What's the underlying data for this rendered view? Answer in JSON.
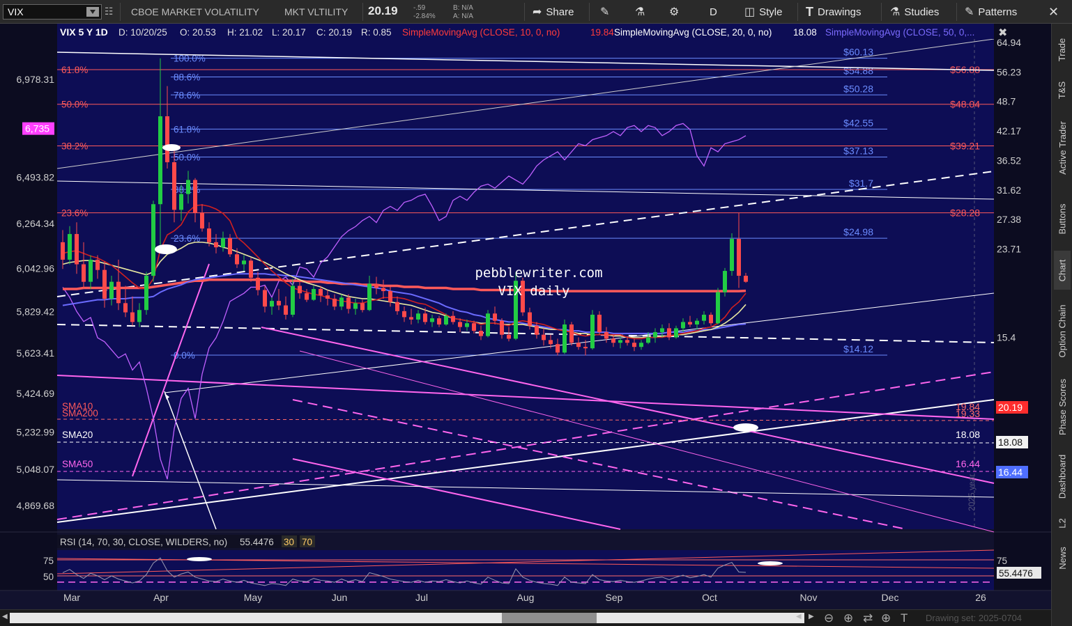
{
  "toolbar": {
    "symbol": "VIX",
    "desc1": "CBOE MARKET VOLATILITY",
    "desc2": "MKT VLTILITY",
    "last": "20.19",
    "change": "-.59",
    "change_pct": "-2.84%",
    "bid": "B: N/A",
    "ask": "A: N/A",
    "share": "Share",
    "period": "D",
    "style": "Style",
    "drawings": "Drawings",
    "studies": "Studies",
    "patterns": "Patterns"
  },
  "sidebar": [
    "Trade",
    "T&S",
    "Active Trader",
    "Buttons",
    "Chart",
    "Option Chain",
    "Phase Scores",
    "Dashboard",
    "L2",
    "News"
  ],
  "header": {
    "title": "VIX 5 Y 1D",
    "date": "D: 10/20/25",
    "open": "O: 20.53",
    "high": "H: 21.02",
    "low": "L: 20.17",
    "close": "C: 20.19",
    "range": "R: 0.85",
    "sma10": "SimpleMovingAvg (CLOSE, 10, 0, no)",
    "sma10_val": "19.84",
    "sma20": "SimpleMovingAvg (CLOSE, 20, 0, no)",
    "sma20_val": "18.08",
    "sma50": "SimpleMovingAvg (CLOSE, 50, 0,..."
  },
  "watermark": {
    "line1": "pebblewriter.com",
    "line2": "VIX daily",
    "year": "2025 year"
  },
  "rsi": {
    "label": "RSI (14, 70, 30, CLOSE, WILDERS, no)",
    "value": "55.4476",
    "ob": "30",
    "os": "70",
    "tick75": "75",
    "tick50": "50",
    "rvalue": "55.4476",
    "rtick75": "75"
  },
  "scroll": {
    "drawing_set": "Drawing set: 2025-0704"
  },
  "chart_data": {
    "type": "candlestick",
    "title": "VIX 5 Y 1D",
    "x_labels": [
      "Mar",
      "Apr",
      "May",
      "Jun",
      "Jul",
      "Aug",
      "Sep",
      "Oct",
      "Nov",
      "Dec",
      "26"
    ],
    "right_axis": [
      "64.94",
      "56.23",
      "48.7",
      "42.17",
      "36.52",
      "31.62",
      "27.38",
      "23.71",
      "15.4"
    ],
    "left_axis": [
      "6,978.31",
      "6,493.82",
      "6,264.34",
      "6,042.96",
      "5,829.42",
      "5,623.41",
      "5,424.69",
      "5,232.99",
      "5,048.07",
      "4,869.68"
    ],
    "left_marker": "6,735",
    "right_markers": [
      {
        "label": "20.19",
        "value": 20.19,
        "color": "#ff2d2d"
      },
      {
        "label": "18.08",
        "value": 18.08,
        "color": "#ffffff"
      },
      {
        "label": "16.44",
        "value": 16.44,
        "color": "#4f6fff"
      }
    ],
    "fib_right": [
      {
        "label": "$60.13",
        "value": 60.13
      },
      {
        "label": "$54.88",
        "value": 54.88
      },
      {
        "label": "$50.28",
        "value": 50.28
      },
      {
        "label": "$42.55",
        "value": 42.55
      },
      {
        "label": "$37.13",
        "value": 37.13
      },
      {
        "label": "$31.7",
        "value": 31.7
      },
      {
        "label": "$24.98",
        "value": 24.98
      },
      {
        "label": "$14.12",
        "value": 14.12
      }
    ],
    "fib_red": [
      {
        "label": "$56.88",
        "value": 56.88,
        "pct": "61.8%"
      },
      {
        "label": "$48.04",
        "value": 48.04,
        "pct": "50.0%"
      },
      {
        "label": "$39.21",
        "value": 39.21,
        "pct": "38.2%"
      },
      {
        "label": "$28.28",
        "value": 28.28,
        "pct": "23.6%"
      }
    ],
    "fib_left_pct": [
      {
        "label": "100.0%",
        "value": 60.13
      },
      {
        "label": "88.6%",
        "value": 54.88
      },
      {
        "label": "78.6%",
        "value": 50.28
      },
      {
        "label": "61.8%",
        "value": 42.55
      },
      {
        "label": "50.0%",
        "value": 37.13
      },
      {
        "label": "38.2%",
        "value": 31.7
      },
      {
        "label": "23.6%",
        "value": 24.98
      },
      {
        "label": "0.0%",
        "value": 14.12
      }
    ],
    "ma_labels": [
      {
        "label": "19.84",
        "value": 19.84,
        "color": "#ff6a6a"
      },
      {
        "label": "19.33",
        "value": 19.33,
        "color": "#ff6a6a"
      },
      {
        "label": "18.08",
        "value": 18.08,
        "color": "#ffffff"
      },
      {
        "label": "16.44",
        "value": 16.44,
        "color": "#ff66ee"
      }
    ],
    "ma_left": [
      "SMA10",
      "SMA200",
      "SMA20",
      "SMA50"
    ],
    "ohlc": [
      [
        24.5,
        26,
        21.5,
        22.5
      ],
      [
        22.5,
        26.5,
        22,
        25.5
      ],
      [
        25.5,
        27,
        21,
        22
      ],
      [
        22,
        24.5,
        19.5,
        20.2
      ],
      [
        20.2,
        23,
        19.5,
        22.5
      ],
      [
        22.5,
        23,
        20.5,
        21.4
      ],
      [
        21.4,
        22.3,
        17.8,
        18.6
      ],
      [
        18.6,
        20.8,
        18,
        20.2
      ],
      [
        20.2,
        22.5,
        17.6,
        18.2
      ],
      [
        18.2,
        19.8,
        17,
        17.4
      ],
      [
        17.4,
        18.8,
        16.3,
        16.6
      ],
      [
        16.6,
        18.2,
        16.2,
        17.6
      ],
      [
        17.6,
        21.2,
        17.2,
        20.8
      ],
      [
        20.8,
        30,
        20.2,
        29.5
      ],
      [
        29.5,
        60.1,
        24,
        45.3
      ],
      [
        45.3,
        52.5,
        35.1,
        36.2
      ],
      [
        36.2,
        38.4,
        27,
        28.7
      ],
      [
        28.7,
        32.5,
        27.2,
        31
      ],
      [
        31,
        34.7,
        29.6,
        33.2
      ],
      [
        33.2,
        33.5,
        27,
        28.3
      ],
      [
        28.3,
        29.5,
        25.8,
        26.2
      ],
      [
        26.2,
        27,
        24,
        24.5
      ],
      [
        24.5,
        25.5,
        23.2,
        23.9
      ],
      [
        23.9,
        25.8,
        23.4,
        25
      ],
      [
        25,
        25.5,
        22.8,
        23.1
      ],
      [
        23.1,
        23.8,
        21.6,
        22
      ],
      [
        22,
        23,
        21.3,
        22.4
      ],
      [
        22.4,
        22.7,
        20.2,
        20.6
      ],
      [
        20.6,
        21.2,
        18.9,
        19.4
      ],
      [
        19.4,
        19.8,
        17.4,
        17.9
      ],
      [
        17.9,
        18.7,
        17.2,
        18.4
      ],
      [
        18.4,
        19.5,
        17.6,
        18
      ],
      [
        18,
        18.8,
        16.8,
        17.2
      ],
      [
        17.2,
        20.5,
        17,
        19.8
      ],
      [
        19.8,
        20.3,
        18.6,
        19.1
      ],
      [
        19.1,
        19.5,
        18.3,
        18.5
      ],
      [
        18.5,
        19.8,
        18.4,
        19.5
      ],
      [
        19.5,
        19.8,
        18.3,
        18.9
      ],
      [
        18.9,
        19.4,
        18,
        18.6
      ],
      [
        18.6,
        19,
        17.6,
        17.9
      ],
      [
        17.9,
        19,
        17.6,
        18.7
      ],
      [
        18.7,
        19,
        17.3,
        17.7
      ],
      [
        17.7,
        18.6,
        17.2,
        18.2
      ],
      [
        18.2,
        18.5,
        17.4,
        17.6
      ],
      [
        17.6,
        20.8,
        17.5,
        20
      ],
      [
        20,
        20.7,
        19,
        19.6
      ],
      [
        19.6,
        20.4,
        18.6,
        19.3
      ],
      [
        19.3,
        19.7,
        17.9,
        18.3
      ],
      [
        18.3,
        18.8,
        17.2,
        17.5
      ],
      [
        17.5,
        17.9,
        16.6,
        17
      ],
      [
        17,
        17.7,
        16.4,
        16.8
      ],
      [
        16.8,
        17.6,
        16.5,
        17.3
      ],
      [
        17.3,
        17.8,
        16.4,
        16.6
      ],
      [
        16.6,
        17.2,
        16.2,
        16.9
      ],
      [
        16.9,
        17.1,
        16.2,
        16.4
      ],
      [
        16.4,
        17.3,
        16.3,
        17.1
      ],
      [
        17.1,
        17.5,
        16.4,
        16.6
      ],
      [
        16.6,
        16.9,
        15.8,
        16.2
      ],
      [
        16.2,
        16.8,
        15.9,
        16.5
      ],
      [
        16.5,
        16.7,
        15.7,
        15.9
      ],
      [
        15.9,
        16.3,
        15.2,
        15.5
      ],
      [
        15.5,
        17.6,
        15.4,
        17.3
      ],
      [
        17.3,
        17.9,
        16.4,
        16.7
      ],
      [
        16.7,
        16.9,
        15.3,
        15.6
      ],
      [
        15.6,
        16.2,
        15.1,
        15.3
      ],
      [
        15.3,
        21.2,
        15.2,
        20.3
      ],
      [
        20.3,
        20.6,
        17.1,
        17.4
      ],
      [
        17.4,
        17.8,
        16,
        16.3
      ],
      [
        16.3,
        16.6,
        15.3,
        15.6
      ],
      [
        15.6,
        16.1,
        14.8,
        15.2
      ],
      [
        15.2,
        15.6,
        14.6,
        14.9
      ],
      [
        14.9,
        15.3,
        14.1,
        14.3
      ],
      [
        14.3,
        16.8,
        14.2,
        16.4
      ],
      [
        16.4,
        16.6,
        14.8,
        15
      ],
      [
        15,
        15.4,
        14.5,
        14.7
      ],
      [
        14.7,
        15.2,
        14.1,
        14.6
      ],
      [
        14.6,
        17.6,
        14.5,
        17.2
      ],
      [
        17.2,
        17.5,
        15.6,
        15.8
      ],
      [
        15.8,
        16.2,
        15,
        15.3
      ],
      [
        15.3,
        15.6,
        14.7,
        15
      ],
      [
        15,
        15.4,
        14.6,
        15.2
      ],
      [
        15.2,
        15.5,
        14.8,
        15
      ],
      [
        15,
        15.3,
        14.4,
        14.7
      ],
      [
        14.7,
        15.2,
        14.5,
        15
      ],
      [
        15,
        15.8,
        14.9,
        15.4
      ],
      [
        15.4,
        16.1,
        15,
        15.8
      ],
      [
        15.8,
        16.4,
        15.4,
        16.1
      ],
      [
        16.1,
        16.5,
        15.2,
        15.4
      ],
      [
        15.4,
        16.3,
        15.3,
        16.1
      ],
      [
        16.1,
        16.9,
        15.8,
        16.6
      ],
      [
        16.6,
        17.1,
        16.2,
        16.4
      ],
      [
        16.4,
        16.9,
        16,
        16.7
      ],
      [
        16.7,
        17.5,
        16.4,
        17.2
      ],
      [
        17.2,
        17.4,
        16.3,
        16.5
      ],
      [
        16.5,
        19.6,
        16.4,
        19.2
      ],
      [
        19.2,
        21.6,
        18.8,
        21.3
      ],
      [
        21.3,
        25.6,
        20.8,
        24.9
      ],
      [
        24.9,
        28.3,
        19.6,
        20.8
      ],
      [
        20.8,
        21.1,
        20.1,
        20.2
      ]
    ],
    "sma10": [
      23.2,
      23.4,
      23.5,
      23.2,
      22.9,
      22.7,
      22.3,
      21.9,
      21.3,
      20.7,
      20.1,
      19.6,
      19.5,
      20.5,
      23.6,
      25.4,
      25.9,
      26.7,
      28.4,
      29.3,
      29.4,
      29.2,
      28.8,
      28.2,
      27.2,
      25.1,
      24.4,
      23.6,
      22.8,
      22,
      21.3,
      20.7,
      20.1,
      19.6,
      19.4,
      19.2,
      19,
      18.9,
      18.7,
      18.5,
      18.4,
      18.3,
      18.2,
      18.2,
      18.4,
      18.5,
      18.7,
      18.7,
      18.7,
      18.6,
      18.4,
      18.2,
      18.1,
      17.8,
      17.5,
      17.2,
      16.9,
      16.8,
      16.7,
      16.6,
      16.4,
      16.5,
      16.5,
      16.4,
      16.3,
      16.6,
      16.7,
      16.6,
      16.5,
      16.4,
      16.2,
      16,
      15.9,
      15.8,
      15.6,
      15.5,
      15.6,
      15.6,
      15.6,
      15.6,
      15.6,
      15.4,
      15.3,
      15.3,
      15.4,
      15.4,
      15.4,
      15.5,
      15.6,
      15.7,
      15.8,
      15.9,
      16.1,
      16.2,
      16.5,
      17,
      17.8,
      18.3,
      19.1
    ],
    "sma20": [
      22,
      22.2,
      22.3,
      22.4,
      22.4,
      22.3,
      22.1,
      21.9,
      21.7,
      21.5,
      21.3,
      21.1,
      20.9,
      21.2,
      22.3,
      23.1,
      23.4,
      23.8,
      24.3,
      24.5,
      24.5,
      24.4,
      24.2,
      23.9,
      23.7,
      23.4,
      23.1,
      22.8,
      22.5,
      22.2,
      21.8,
      21.4,
      21,
      20.7,
      20.4,
      20.1,
      19.9,
      19.7,
      19.4,
      19.2,
      19,
      18.8,
      18.7,
      18.6,
      18.6,
      18.5,
      18.4,
      18.3,
      18.2,
      18.1,
      18,
      17.8,
      17.6,
      17.4,
      17.3,
      17.1,
      16.9,
      16.8,
      16.7,
      16.6,
      16.5,
      16.5,
      16.5,
      16.4,
      16.4,
      16.4,
      16.4,
      16.3,
      16.2,
      16.1,
      16,
      16,
      15.9,
      15.8,
      15.7,
      15.7,
      15.6,
      15.6,
      15.6,
      15.5,
      15.5,
      15.4,
      15.4,
      15.4,
      15.4,
      15.4,
      15.5,
      15.5,
      15.6,
      15.6,
      15.7,
      15.8,
      15.9,
      16,
      16.2,
      16.5,
      16.9,
      17.4,
      18.08
    ],
    "sma50": [
      18,
      18.1,
      18.2,
      18.3,
      18.4,
      18.5,
      18.5,
      18.6,
      18.6,
      18.6,
      18.7,
      18.7,
      18.7,
      18.8,
      19.2,
      19.5,
      19.7,
      19.9,
      20.2,
      20.4,
      20.5,
      20.6,
      20.7,
      20.8,
      20.9,
      21,
      21,
      21,
      21,
      21,
      20.9,
      20.9,
      20.8,
      20.8,
      20.7,
      20.6,
      20.5,
      20.4,
      20.3,
      20.2,
      20.1,
      20,
      19.9,
      19.8,
      19.7,
      19.6,
      19.5,
      19.3,
      19.2,
      19.1,
      19,
      18.8,
      18.6,
      18.4,
      18.2,
      17.9,
      17.7,
      17.5,
      17.4,
      17.2,
      17.1,
      16.9,
      16.8,
      16.7,
      16.6,
      16.6,
      16.5,
      16.4,
      16.3,
      16.2,
      16.1,
      16,
      16,
      15.9,
      15.9,
      15.8,
      15.8,
      15.8,
      15.8,
      15.7,
      15.7,
      15.7,
      15.7,
      15.7,
      15.7,
      15.7,
      15.7,
      15.8,
      15.8,
      15.8,
      15.9,
      15.9,
      16,
      16,
      16.1,
      16.2,
      16.3,
      16.4,
      16.44
    ],
    "sma200": [
      19.5,
      19.5,
      19.5,
      19.6,
      19.6,
      19.6,
      19.6,
      19.6,
      19.6,
      19.6,
      19.6,
      19.6,
      19.6,
      19.7,
      19.8,
      19.9,
      20,
      20.1,
      20.2,
      20.3,
      20.3,
      20.4,
      20.4,
      20.4,
      20.4,
      20.4,
      20.4,
      20.4,
      20.4,
      20.4,
      20.4,
      20.4,
      20.3,
      20.3,
      20.3,
      20.2,
      20.2,
      20.2,
      20.1,
      20.1,
      20,
      20,
      20,
      19.9,
      19.9,
      19.9,
      19.8,
      19.8,
      19.8,
      19.7,
      19.7,
      19.7,
      19.6,
      19.6,
      19.6,
      19.6,
      19.5,
      19.5,
      19.5,
      19.5,
      19.4,
      19.4,
      19.4,
      19.4,
      19.4,
      19.4,
      19.4,
      19.4,
      19.4,
      19.3,
      19.3,
      19.3,
      19.3,
      19.3,
      19.3,
      19.3,
      19.3,
      19.3,
      19.3,
      19.3,
      19.3,
      19.3,
      19.3,
      19.3,
      19.3,
      19.3,
      19.3,
      19.3,
      19.3,
      19.3,
      19.3,
      19.3,
      19.3,
      19.3,
      19.3,
      19.3,
      19.3,
      19.3,
      19.33
    ],
    "spx_path": [
      5950,
      5900,
      5830,
      5780,
      5800,
      5700,
      5680,
      5640,
      5600,
      5620,
      5540,
      5580,
      5450,
      5300,
      5100,
      5000,
      5250,
      5400,
      5450,
      5300,
      5520,
      5650,
      5700,
      5780,
      5880,
      5900,
      5920,
      5950,
      5950,
      5960,
      5900,
      5980,
      6000,
      5960,
      6050,
      6040,
      6000,
      6070,
      6100,
      6150,
      6200,
      6230,
      6250,
      6280,
      6300,
      6270,
      6330,
      6350,
      6330,
      6370,
      6380,
      6400,
      6410,
      6350,
      6280,
      6300,
      6380,
      6400,
      6380,
      6420,
      6450,
      6460,
      6440,
      6470,
      6500,
      6480,
      6460,
      6500,
      6550,
      6580,
      6600,
      6620,
      6580,
      6620,
      6660,
      6650,
      6680,
      6690,
      6700,
      6720,
      6700,
      6740,
      6750,
      6720,
      6750,
      6740,
      6700,
      6720,
      6750,
      6760,
      6730,
      6600,
      6550,
      6640,
      6620,
      6660,
      6670,
      6680,
      6700
    ],
    "rsi_values": [
      55,
      60,
      52,
      46,
      54,
      50,
      44,
      50,
      45,
      42,
      39,
      42,
      52,
      70,
      78,
      58,
      48,
      53,
      56,
      48,
      45,
      42,
      41,
      45,
      42,
      40,
      43,
      39,
      37,
      35,
      38,
      37,
      35,
      45,
      42,
      41,
      46,
      43,
      42,
      40,
      45,
      41,
      44,
      41,
      55,
      52,
      49,
      45,
      43,
      41,
      40,
      43,
      40,
      42,
      41,
      44,
      41,
      39,
      42,
      39,
      37,
      48,
      43,
      39,
      38,
      61,
      48,
      43,
      40,
      38,
      37,
      35,
      48,
      40,
      39,
      38,
      52,
      44,
      42,
      41,
      43,
      41,
      40,
      42,
      45,
      47,
      48,
      44,
      48,
      51,
      47,
      49,
      52,
      48,
      62,
      67,
      71,
      56,
      55.4476
    ]
  }
}
